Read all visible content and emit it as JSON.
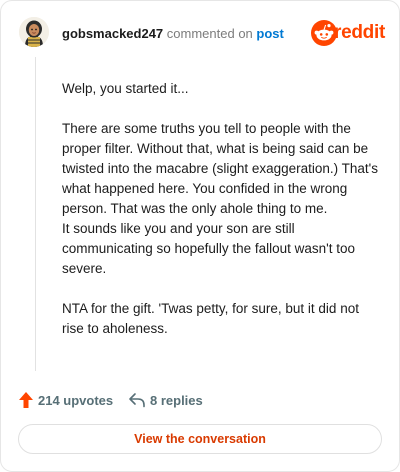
{
  "header": {
    "username": "gobsmacked247",
    "action_text": "commented on",
    "post_link": "post",
    "brand_name": "reddit"
  },
  "comment": {
    "paragraphs": [
      "Welp, you started it...",
      "There are some truths you tell to people with the proper filter. Without that, what is being said can be twisted into the macabre (slight exaggeration.) That's what happened here. You confided in the wrong person. That was the only ahole thing to me.\nIt sounds like you and your son are still communicating so hopefully the fallout wasn't too severe.",
      "NTA for the gift. 'Twas petty, for sure, but it did not rise to aholeness."
    ]
  },
  "actions": {
    "upvotes_label": "214 upvotes",
    "replies_label": "8 replies",
    "upvote_icon": "upvote-arrow-icon",
    "reply_icon": "reply-arrow-icon"
  },
  "footer": {
    "view_conversation_label": "View the conversation"
  },
  "colors": {
    "brand": "#ff4500",
    "link": "#0079d3",
    "cta": "#d93a00",
    "muted": "#576f76"
  }
}
